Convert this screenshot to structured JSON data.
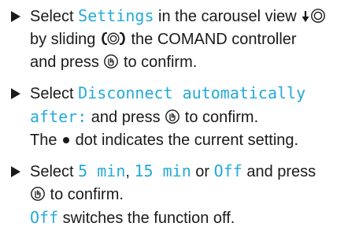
{
  "accent_color": "#25a9d9",
  "steps": [
    {
      "bullet_icon": "triangle-bullet-icon",
      "line1": {
        "t1": "Select ",
        "d1": "Settings",
        "t2": " in the carousel view ",
        "icons": [
          "arrow-down-icon",
          "controller-icon"
        ]
      },
      "line2": {
        "t1": "by sliding ",
        "icon": "controller-slide-left-right-icon",
        "t2": " the COMAND controller"
      },
      "line3": {
        "t1": "and press ",
        "icon": "controller-press-icon",
        "t2": " to confirm."
      }
    },
    {
      "bullet_icon": "triangle-bullet-icon",
      "line1": {
        "t1": "Select ",
        "d1": "Disconnect automatically"
      },
      "line2": {
        "d1": "after:",
        "t1": " and press ",
        "icon": "controller-press-icon",
        "t2": " to confirm."
      },
      "line3": {
        "t1": "The ",
        "icon": "dot-icon",
        "t2": " dot indicates the current setting."
      }
    },
    {
      "bullet_icon": "triangle-bullet-icon",
      "line1": {
        "t1": "Select ",
        "d1": "5 min",
        "t2": ", ",
        "d2": "15 min",
        "t3": " or ",
        "d3": "Off",
        "t4": " and press"
      },
      "line2": {
        "icon": "controller-press-icon",
        "t1": " to confirm."
      },
      "line3": {
        "d1": "Off",
        "t1": " switches the function off."
      }
    }
  ]
}
